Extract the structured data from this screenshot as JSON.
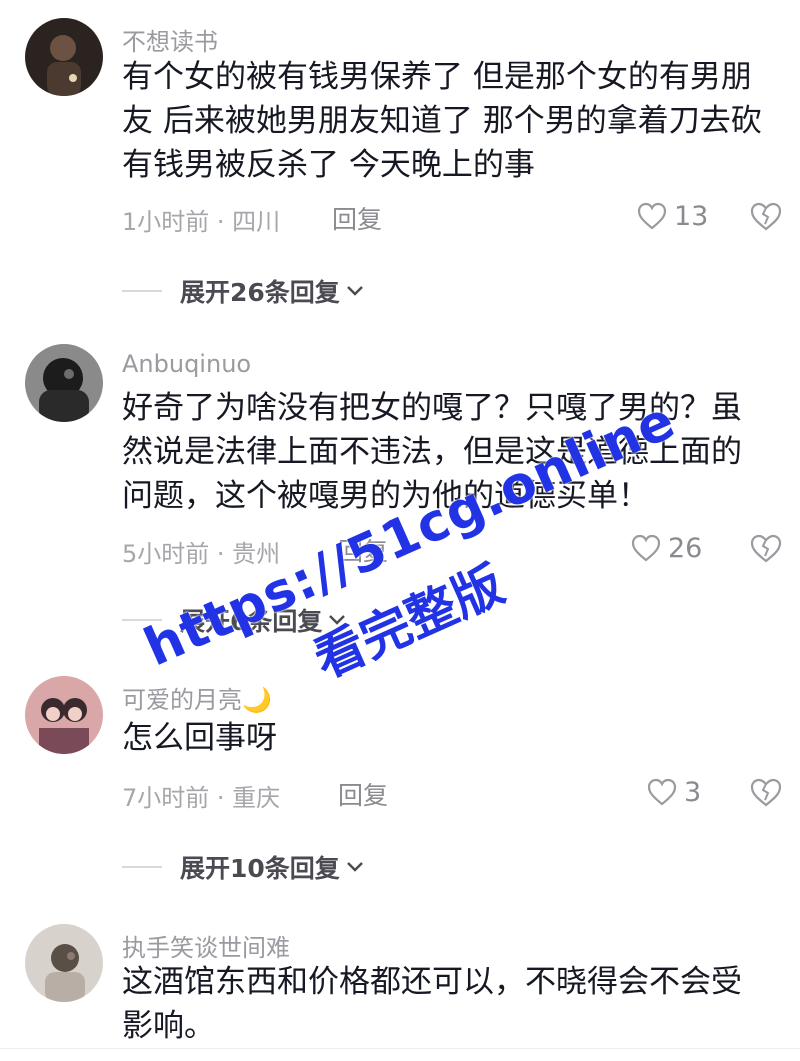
{
  "comments": [
    {
      "username": "不想读书",
      "lines": [
        "有个女的被有钱男保养了 但是那个女的有男朋",
        "友 后来被她男朋友知道了 那个男的拿着刀去砍",
        "有钱男被反杀了 今天晚上的事"
      ],
      "meta": "1小时前 · 四川",
      "reply_label": "回复",
      "likes": "13",
      "expand_label": "展开26条回复",
      "avatar_colors": [
        "#2b2320",
        "#6b5242"
      ]
    },
    {
      "username": "Anbuqinuo",
      "lines": [
        "好奇了为啥没有把女的嘎了？只嘎了男的？虽",
        "然说是法律上面不违法，但是这是道德上面的",
        "问题，这个被嘎男的为他的道德买单！"
      ],
      "meta": "5小时前 · 贵州",
      "reply_label": "回复",
      "likes": "26",
      "expand_label": "展开6条回复",
      "avatar_colors": [
        "#1c1c1c",
        "#6d6d6d"
      ]
    },
    {
      "username": "可爱的月亮🌙",
      "lines": [
        "怎么回事呀"
      ],
      "meta": "7小时前 · 重庆",
      "reply_label": "回复",
      "likes": "3",
      "expand_label": "展开10条回复",
      "avatar_colors": [
        "#3a2a2e",
        "#d9a7a7"
      ]
    },
    {
      "username": "执手笑谈世间难",
      "lines": [
        "这酒馆东西和价格都还可以，不晓得会不会受",
        "影响。"
      ],
      "avatar_colors": [
        "#b9aea5",
        "#5a4f47"
      ]
    }
  ],
  "watermark": {
    "url": "https://51cg.online",
    "caption": "看完整版",
    "color": "#2233e6"
  },
  "icons": {
    "like": "heart-outline-icon",
    "dislike": "broken-heart-icon",
    "expand": "chevron-down-icon"
  }
}
